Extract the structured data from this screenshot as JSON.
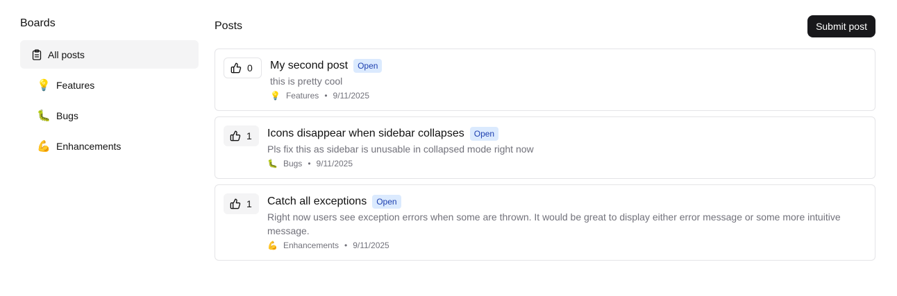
{
  "sidebar": {
    "title": "Boards",
    "items": [
      {
        "label": "All posts",
        "icon": "clipboard-icon",
        "active": true
      },
      {
        "label": "Features",
        "icon": "💡"
      },
      {
        "label": "Bugs",
        "icon": "🐛"
      },
      {
        "label": "Enhancements",
        "icon": "💪"
      }
    ]
  },
  "main": {
    "title": "Posts",
    "submit_label": "Submit post"
  },
  "posts": [
    {
      "votes": "0",
      "title": "My second post",
      "status": "Open",
      "description": "this is pretty cool",
      "board_icon": "💡",
      "board": "Features",
      "separator": "•",
      "date": "9/11/2025"
    },
    {
      "votes": "1",
      "title": "Icons disappear when sidebar collapses",
      "status": "Open",
      "description": "Pls fix this as sidebar is unusable in collapsed mode right now",
      "board_icon": "🐛",
      "board": "Bugs",
      "separator": "•",
      "date": "9/11/2025"
    },
    {
      "votes": "1",
      "title": "Catch all exceptions",
      "status": "Open",
      "description": "Right now users see exception errors when some are thrown. It would be great to display either error message or some more intuitive message.",
      "board_icon": "💪",
      "board": "Enhancements",
      "separator": "•",
      "date": "9/11/2025"
    }
  ],
  "colors": {
    "badge_bg": "#dbeafe",
    "badge_text": "#1e40af",
    "primary_button": "#18181b"
  }
}
